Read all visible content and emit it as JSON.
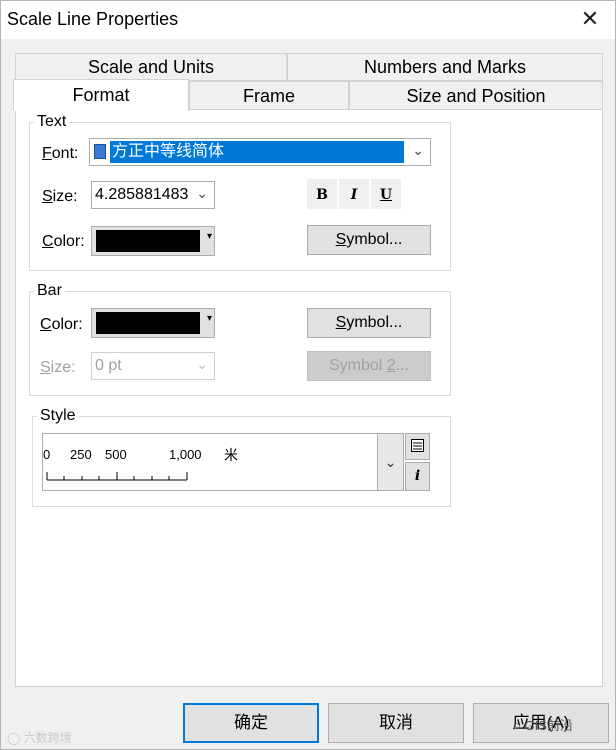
{
  "window": {
    "title": "Scale Line Properties",
    "close_glyph": "✕"
  },
  "tabs": {
    "row1": [
      "Scale and Units",
      "Numbers and Marks"
    ],
    "row2": [
      "Format",
      "Frame",
      "Size and Position"
    ],
    "selected": "Format"
  },
  "text_group": {
    "legend": "Text",
    "font_label_pre": "F",
    "font_label_post": "ont:",
    "font_value": "方正中等线简体",
    "size_label_pre": "S",
    "size_label_post": "ize:",
    "size_value": "4.285881483",
    "bold": "B",
    "italic": "I",
    "underline": "U",
    "color_label_pre": "C",
    "color_label_post": "olor:",
    "color_value": "#000000",
    "symbol_button_pre": "S",
    "symbol_button_post": "ymbol..."
  },
  "bar_group": {
    "legend": "Bar",
    "color_label_pre": "C",
    "color_label_post": "olor:",
    "color_value": "#000000",
    "symbol_button_pre": "S",
    "symbol_button_post": "ymbol...",
    "size_label_pre": "S",
    "size_label_post": "ize:",
    "size_value": "0 pt",
    "symbol2_button_pre": "Symbol ",
    "symbol2_button_mid": "2",
    "symbol2_button_post": "..."
  },
  "style_group": {
    "legend": "Style",
    "ticks": [
      "0",
      "250",
      "500",
      "1,000"
    ],
    "unit": "米"
  },
  "footer": {
    "ok": "确定",
    "cancel": "取消",
    "apply": "应用(A)"
  },
  "watermark": {
    "left": "六数跨境",
    "right": "GIS前沿"
  }
}
